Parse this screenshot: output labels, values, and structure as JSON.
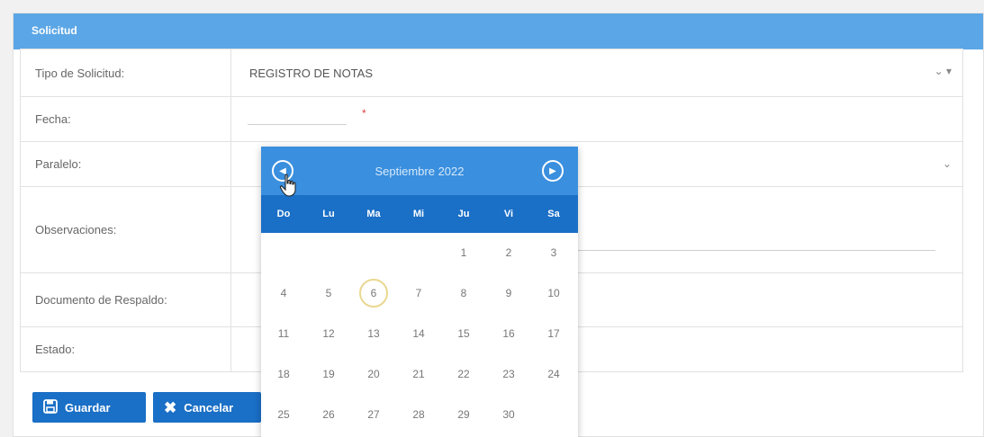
{
  "panel": {
    "title": "Solicitud"
  },
  "form": {
    "tipo": {
      "label": "Tipo de Solicitud:",
      "value": "REGISTRO DE NOTAS"
    },
    "fecha": {
      "label": "Fecha:",
      "required_mark": "*"
    },
    "paralelo": {
      "label": "Paralelo:"
    },
    "observaciones": {
      "label": "Observaciones:"
    },
    "documento": {
      "label": "Documento de Respaldo:"
    },
    "estado": {
      "label": "Estado:"
    }
  },
  "buttons": {
    "save": "Guardar",
    "cancel": "Cancelar"
  },
  "datepicker": {
    "title": "Septiembre 2022",
    "weekdays": [
      "Do",
      "Lu",
      "Ma",
      "Mi",
      "Ju",
      "Vi",
      "Sa"
    ],
    "weeks": [
      [
        "",
        "",
        "",
        "",
        "1",
        "2",
        "3"
      ],
      [
        "4",
        "5",
        "6",
        "7",
        "8",
        "9",
        "10"
      ],
      [
        "11",
        "12",
        "13",
        "14",
        "15",
        "16",
        "17"
      ],
      [
        "18",
        "19",
        "20",
        "21",
        "22",
        "23",
        "24"
      ],
      [
        "25",
        "26",
        "27",
        "28",
        "29",
        "30",
        ""
      ]
    ],
    "today": "6"
  },
  "colors": {
    "header": "#5ba6e6",
    "picker_header": "#3a8fde",
    "picker_weekdays": "#1a6fc6",
    "button": "#1a6fc6",
    "required": "#e04040"
  },
  "icons": {
    "save": "floppy-disk-icon",
    "cancel": "x-icon",
    "prev": "chevron-left-circle-icon",
    "next": "chevron-right-circle-icon",
    "dropdown": "chevron-down-icon"
  }
}
